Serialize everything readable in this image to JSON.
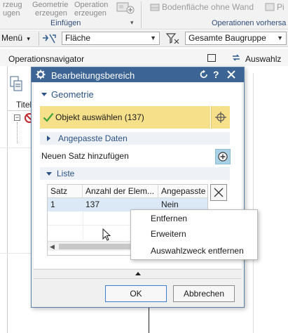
{
  "ribbon": {
    "cmd1_line1": "rzeug",
    "cmd1_line2": "ugen",
    "cmd2_line1": "Geometrie",
    "cmd2_line2": "erzeugen",
    "cmd3_line1": "Operation",
    "cmd3_line2": "erzeugen",
    "group_einfuegen": "Einfügen",
    "bodenflaeche": "Bodenfläche ohne Wand",
    "pi_label": "Pi",
    "group_operationen": "Operationen vorhersa"
  },
  "selbar": {
    "menu_label": "Menü",
    "filter_value": "Fläche",
    "scope_value": "Gesamte Baugruppe"
  },
  "navigator": {
    "title": "Operationsnavigator",
    "column_title": "Titel",
    "auswahl_label": "Auswahlz"
  },
  "dialog": {
    "title": "Bearbeitungsbereich",
    "geometry_section": "Geometrie",
    "select_object": "Objekt auswählen (137)",
    "custom_data": "Angepasste Daten",
    "add_set": "Neuen Satz hinzufügen",
    "list_section": "Liste",
    "table": {
      "headers": [
        "Satz",
        "Anzahl der Elem...",
        "Angepasste"
      ],
      "rows": [
        [
          "1",
          "137",
          "Nein"
        ]
      ]
    },
    "ok_label": "OK",
    "cancel_label": "Abbrechen"
  },
  "context_menu": {
    "items": [
      "Entfernen",
      "Erweitern",
      "Auswahlzweck entfernen"
    ]
  },
  "colors": {
    "title_bar": "#3c6494",
    "highlight_row": "#f6e08a",
    "selected_row": "#dbe8f6",
    "accent": "#2b5288"
  }
}
